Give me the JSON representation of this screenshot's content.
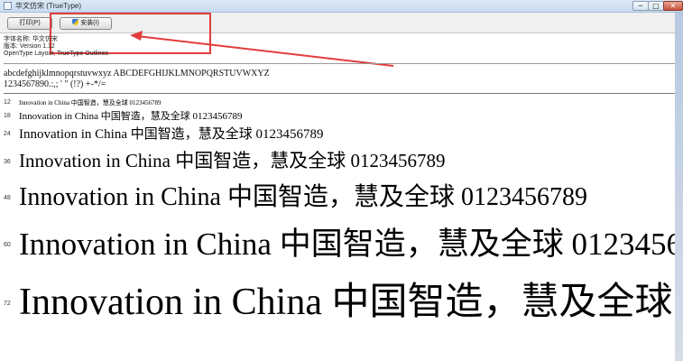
{
  "window": {
    "title": "华文仿宋 (TrueType)",
    "minimize_glyph": "─",
    "maximize_glyph": "□",
    "close_glyph": "✕"
  },
  "toolbar": {
    "print_label": "打印(P)",
    "install_label": "安装(I)"
  },
  "info": {
    "font_name": "字体名称: 华文仿宋",
    "version": "版本: Version 1.12",
    "type": "OpenType Layout, TrueType Outlines"
  },
  "alphabet": {
    "letters": "abcdefghijklmnopqrstuvwxyz ABCDEFGHIJKLMNOPQRSTUVWXYZ",
    "digits": "1234567890.:,; ' \" (!?) +-*/="
  },
  "samples": {
    "text": "Innovation in China 中国智造，慧及全球 0123456789",
    "rows": [
      {
        "size": "12"
      },
      {
        "size": "18"
      },
      {
        "size": "24"
      },
      {
        "size": "36"
      },
      {
        "size": "48"
      },
      {
        "size": "60"
      },
      {
        "size": "72"
      }
    ]
  },
  "annotation": {
    "color": "#e23c3c"
  }
}
